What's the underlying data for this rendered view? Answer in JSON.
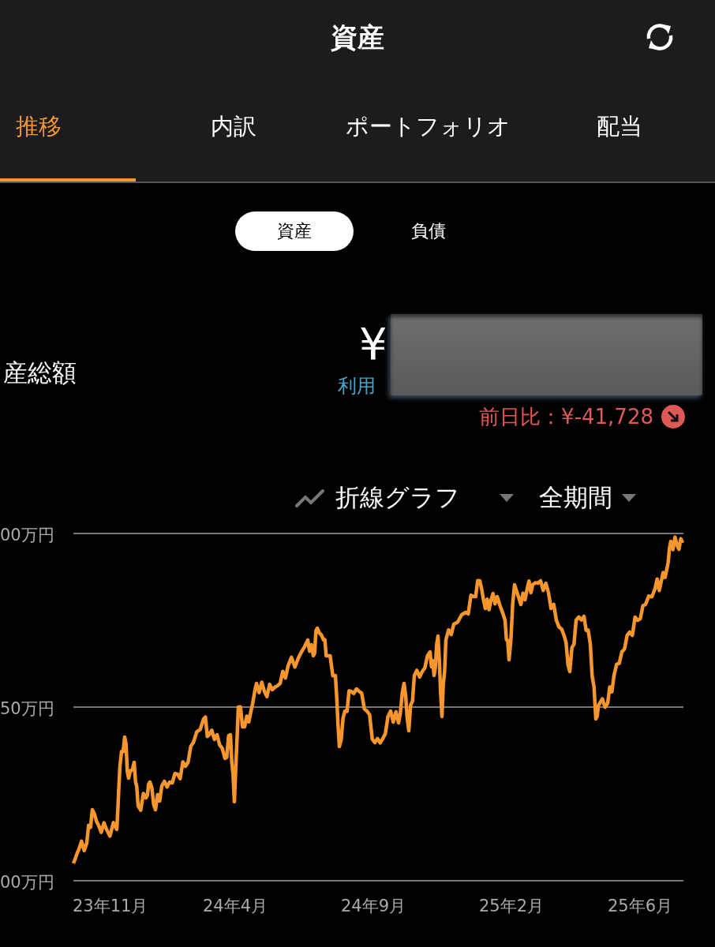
{
  "header": {
    "title": "資産"
  },
  "tabs": [
    {
      "label": "推移",
      "selected": true
    },
    {
      "label": "内訳",
      "selected": false
    },
    {
      "label": "ポートフォリオ",
      "selected": false
    },
    {
      "label": "配当",
      "selected": false
    }
  ],
  "segments": [
    {
      "label": "資産",
      "selected": true
    },
    {
      "label": "負債",
      "selected": false
    }
  ],
  "summary": {
    "label": "産総額",
    "currency": "¥",
    "available_label": "利用",
    "change": "前日比：¥-41,728",
    "down": true
  },
  "chart_controls": {
    "type": "折線グラフ",
    "period": "全期間"
  },
  "chart": {
    "y_labels": [
      "00万円",
      "50万円",
      "00万円"
    ],
    "x_labels": [
      "23年11月",
      "24年4月",
      "24年9月",
      "25年2月",
      "25年6月"
    ]
  }
}
